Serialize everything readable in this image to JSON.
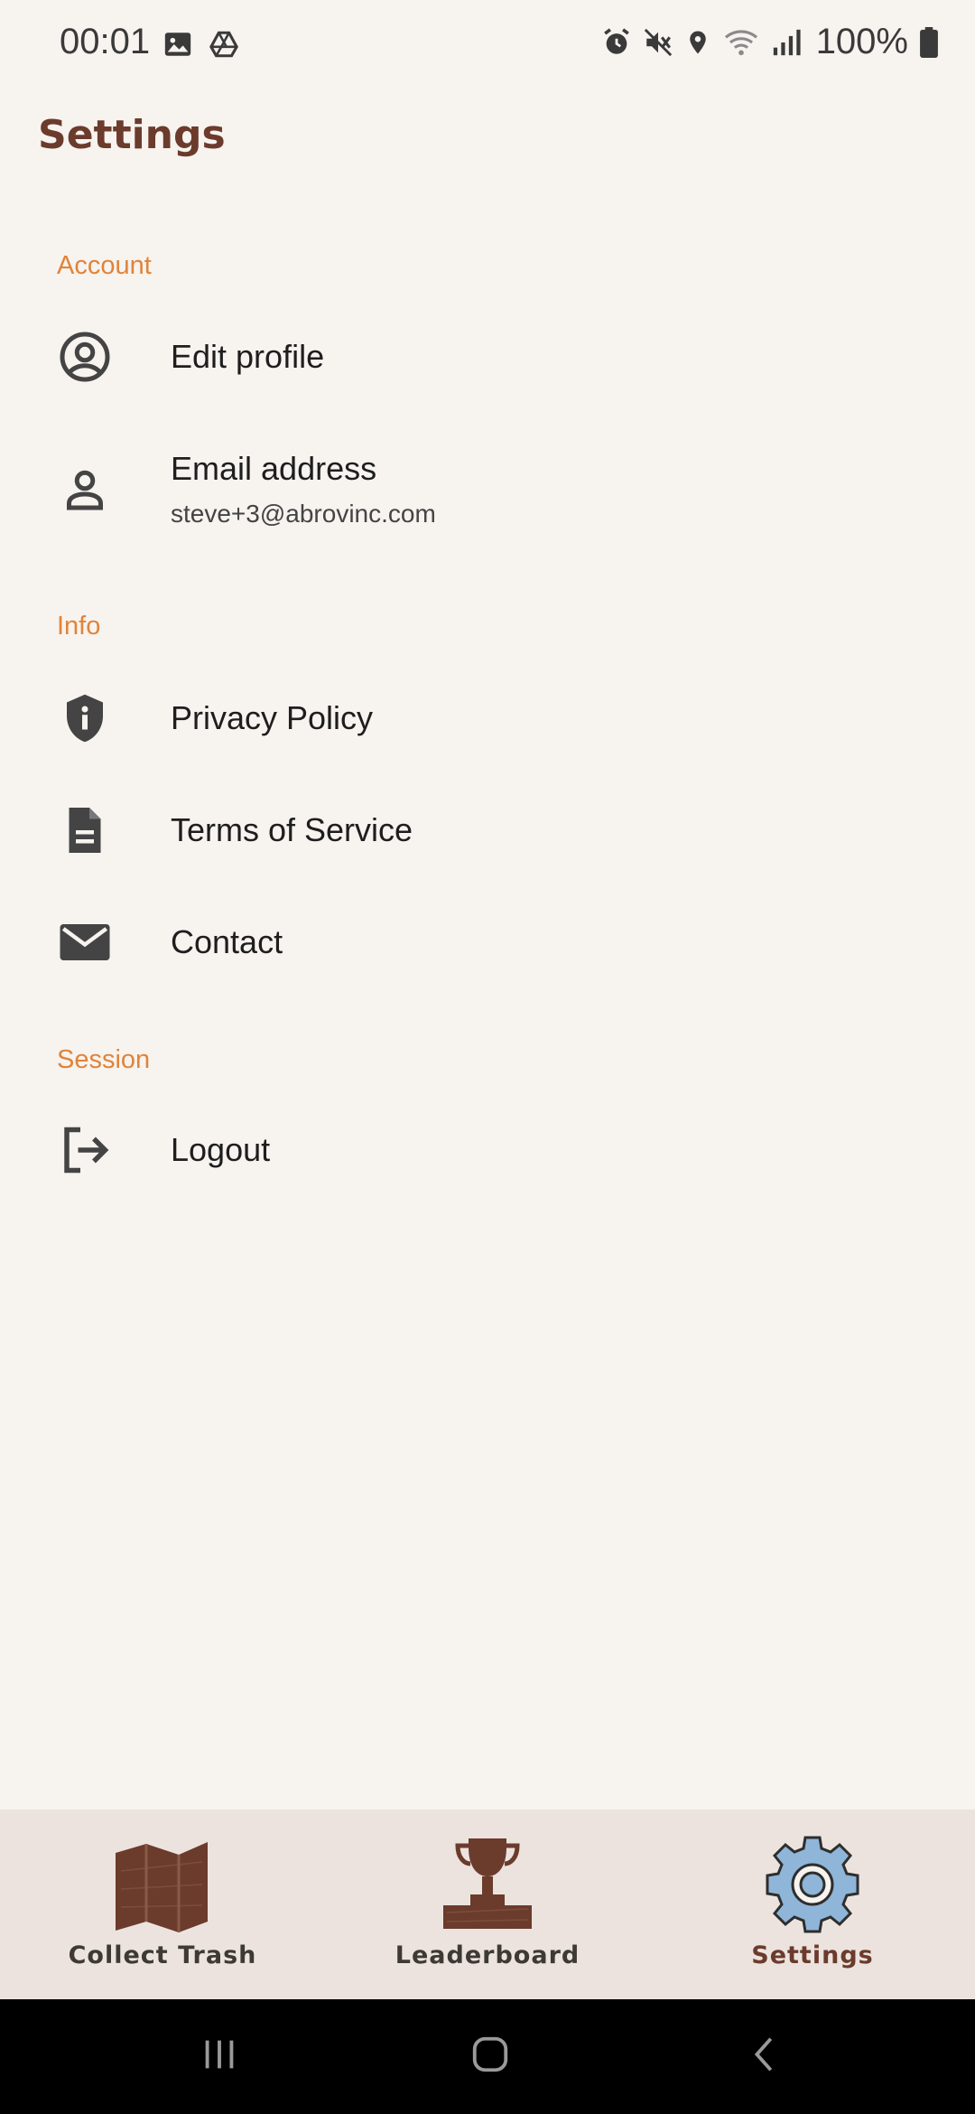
{
  "status_bar": {
    "time": "00:01",
    "battery": "100%",
    "icons_left": [
      "image-icon",
      "drive-icon"
    ],
    "icons_right": [
      "alarm-icon",
      "mute-icon",
      "location-icon",
      "wifi-icon",
      "signal-icon",
      "battery-icon"
    ]
  },
  "header": {
    "title": "Settings"
  },
  "sections": {
    "account": {
      "label": "Account",
      "edit_profile": "Edit profile",
      "email_title": "Email address",
      "email_value": "steve+3@abrovinc.com"
    },
    "info": {
      "label": "Info",
      "privacy": "Privacy Policy",
      "terms": "Terms of Service",
      "contact": "Contact"
    },
    "session": {
      "label": "Session",
      "logout": "Logout"
    }
  },
  "bottom_nav": {
    "items": [
      {
        "label": "Collect Trash",
        "icon": "map-icon",
        "active": false
      },
      {
        "label": "Leaderboard",
        "icon": "trophy-icon",
        "active": false
      },
      {
        "label": "Settings",
        "icon": "gear-icon",
        "active": true
      }
    ]
  },
  "colors": {
    "background": "#f7f3ef",
    "title": "#6b3b2c",
    "section_header": "#e0843a",
    "nav_background": "#ece3df",
    "gear_blue": "#8fb5d8"
  }
}
